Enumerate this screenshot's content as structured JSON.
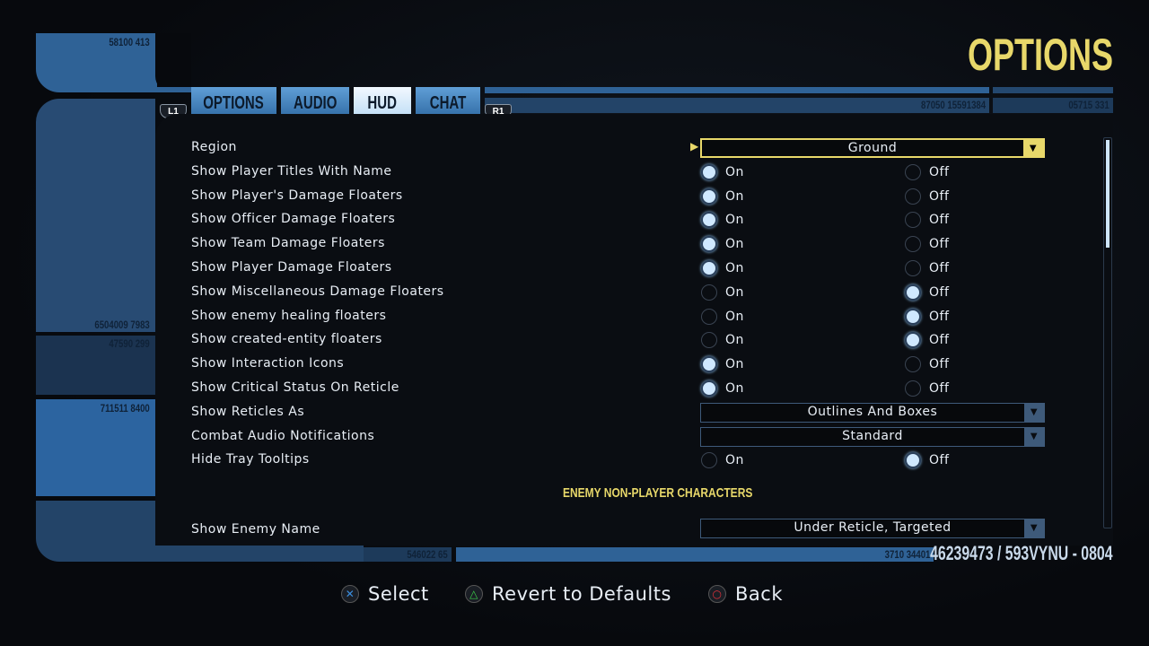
{
  "title": "OPTIONS",
  "tabs": [
    {
      "label": "OPTIONS",
      "active": false
    },
    {
      "label": "AUDIO",
      "active": false
    },
    {
      "label": "HUD",
      "active": true
    },
    {
      "label": "CHAT",
      "active": false
    }
  ],
  "shoulder_left": "L1",
  "shoulder_right": "R1",
  "deco_numbers": {
    "top_left": "58100 413",
    "left_1": "6504009 7983",
    "left_2": "47590 299",
    "left_3": "711511 8400",
    "top_bar_1": "87050 15591384",
    "top_bar_2": "05715 331",
    "bottom_bar_1": "546022 65",
    "bottom_bar_2": "3710 34401",
    "stardate": "46239473 / 593VYNU - 0804"
  },
  "labels": {
    "on": "On",
    "off": "Off"
  },
  "settings": [
    {
      "label": "Region",
      "type": "dropdown",
      "value": "Ground",
      "selected": true
    },
    {
      "label": "Show Player Titles With Name",
      "type": "toggle",
      "value": "On"
    },
    {
      "label": "Show Player's Damage Floaters",
      "type": "toggle",
      "value": "On"
    },
    {
      "label": "Show Officer Damage Floaters",
      "type": "toggle",
      "value": "On"
    },
    {
      "label": "Show Team Damage Floaters",
      "type": "toggle",
      "value": "On"
    },
    {
      "label": "Show Player Damage Floaters",
      "type": "toggle",
      "value": "On"
    },
    {
      "label": "Show Miscellaneous Damage Floaters",
      "type": "toggle",
      "value": "Off"
    },
    {
      "label": "Show enemy healing floaters",
      "type": "toggle",
      "value": "Off"
    },
    {
      "label": "Show created-entity floaters",
      "type": "toggle",
      "value": "Off"
    },
    {
      "label": "Show Interaction Icons",
      "type": "toggle",
      "value": "On"
    },
    {
      "label": "Show Critical Status On Reticle",
      "type": "toggle",
      "value": "On"
    },
    {
      "label": "Show Reticles As",
      "type": "dropdown",
      "value": "Outlines And Boxes"
    },
    {
      "label": "Combat Audio Notifications",
      "type": "dropdown",
      "value": "Standard"
    },
    {
      "label": "Hide Tray Tooltips",
      "type": "toggle",
      "value": "Off"
    }
  ],
  "section_header": "ENEMY NON-PLAYER CHARACTERS",
  "next_setting": {
    "label": "Show Enemy Name",
    "value": "Under Reticle, Targeted"
  },
  "footer": [
    {
      "icon": "cross",
      "label": "Select",
      "color": "#3b8fe0"
    },
    {
      "icon": "triangle",
      "label": "Revert to Defaults",
      "color": "#3ccf4a"
    },
    {
      "icon": "circle",
      "label": "Back",
      "color": "#e0303a"
    }
  ],
  "colors": {
    "accent": "#e8d86a",
    "lcars_blue": "#2f5d8c"
  }
}
